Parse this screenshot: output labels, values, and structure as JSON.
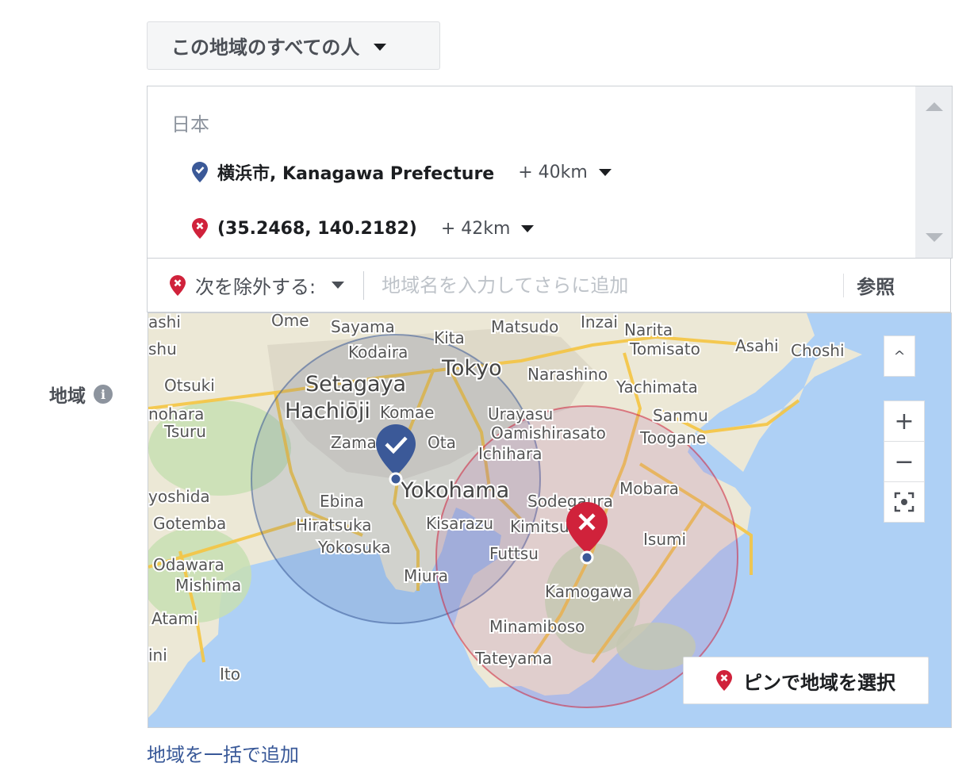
{
  "audience": {
    "label": "この地域のすべての人"
  },
  "section": {
    "label": "地域"
  },
  "locations": {
    "country": "日本",
    "included": {
      "name": "横浜市, Kanagawa Prefecture",
      "radius": "+ 40km"
    },
    "excluded": {
      "name": "(35.2468, 140.2182)",
      "radius": "+ 42km"
    }
  },
  "search": {
    "mode_label": "次を除外する:",
    "placeholder": "地域名を入力してさらに追加",
    "browse_label": "参照"
  },
  "map": {
    "labels": [
      "ashi",
      "Ome",
      "Sayama",
      "Kita",
      "Matsudo",
      "Inzai",
      "Narita",
      "shu",
      "Kodaira",
      "Tokyo",
      "Tomisato",
      "Asahi",
      "Choshi",
      "Otsuki",
      "Setagaya",
      "Narashino",
      "Yachimata",
      "nohara",
      "Hachiōji",
      "Komae",
      "Urayasu",
      "Sanmu",
      "Tsuru",
      "Oamishirasato",
      "Zama",
      "Ota",
      "Toogane",
      "Ichihara",
      "yoshida",
      "Ebina",
      "Yokohama",
      "Sodegaura",
      "Mobara",
      "Gotemba",
      "Hiratsuka",
      "Kisarazu",
      "Kimitsu",
      "Yokosuka",
      "Futtsu",
      "Isumi",
      "Odawara",
      "Mishima",
      "Miura",
      "Kamogawa",
      "Atami",
      "Minamiboso",
      "ini",
      "Tateyama",
      "Ito"
    ],
    "pin_button_label": "ピンで地域を選択",
    "zoom_in": "+",
    "zoom_out": "−",
    "collapse": "^"
  },
  "bulk_add_link": "地域を一括で追加",
  "colors": {
    "include": "#3b5998",
    "exclude": "#d0223b",
    "water": "#aed0f5",
    "land": "#ece8d6",
    "link": "#385898"
  }
}
